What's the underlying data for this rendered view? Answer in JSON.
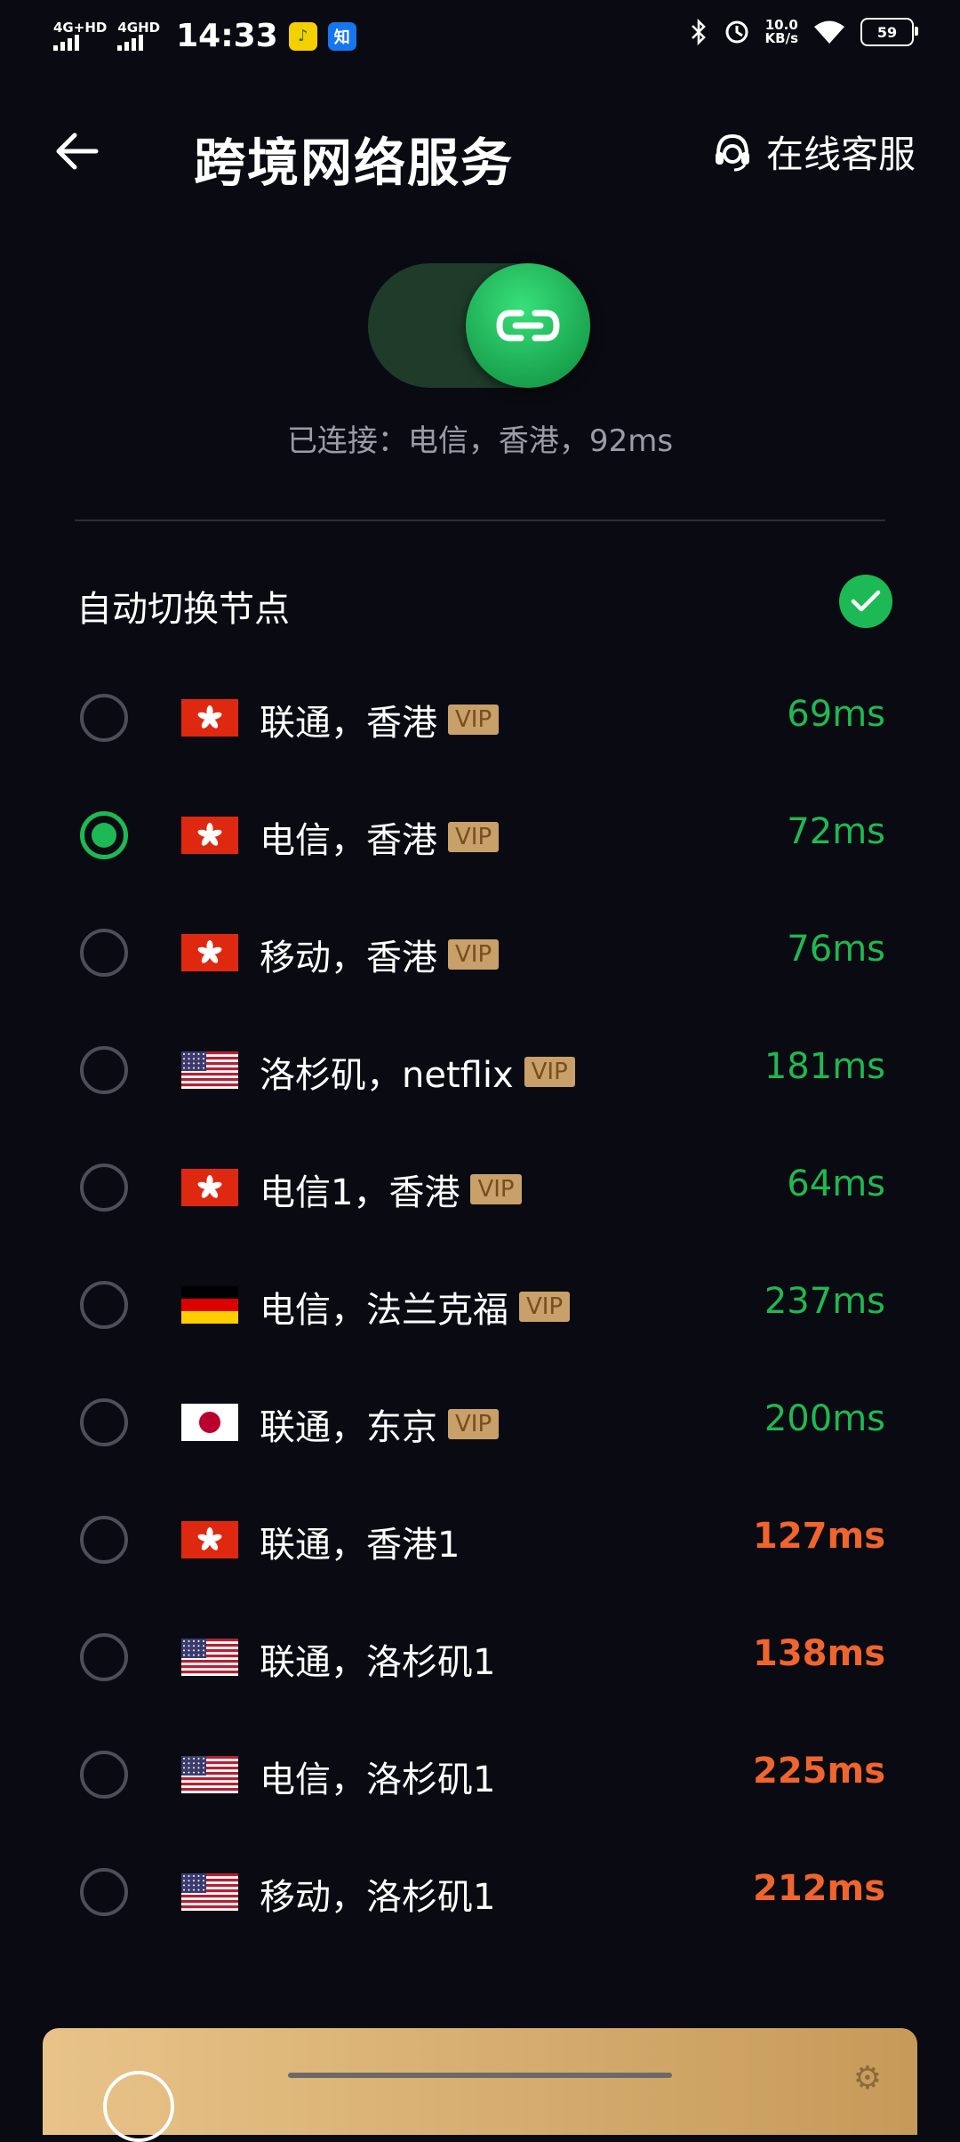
{
  "status_bar": {
    "net1": "4G+HD",
    "net2": "4GHD",
    "time": "14:33",
    "app_icons": [
      "qq-music-icon",
      "zhihu-icon"
    ],
    "app_icon_zhihu_text": "知",
    "speed_value": "10.0",
    "speed_unit": "KB/s",
    "battery": "59"
  },
  "header": {
    "title": "跨境网络服务",
    "support_label": "在线客服"
  },
  "connection": {
    "connected": true,
    "status_text": "已连接：电信，香港，92ms"
  },
  "auto_switch": {
    "label": "自动切换节点",
    "enabled": true
  },
  "vip_label": "VIP",
  "nodes": [
    {
      "flag": "hk",
      "name": "联通，香港",
      "vip": true,
      "latency": "69ms",
      "latency_status": "good",
      "selected": false
    },
    {
      "flag": "hk",
      "name": "电信，香港",
      "vip": true,
      "latency": "72ms",
      "latency_status": "good",
      "selected": true
    },
    {
      "flag": "hk",
      "name": "移动，香港",
      "vip": true,
      "latency": "76ms",
      "latency_status": "good",
      "selected": false
    },
    {
      "flag": "us",
      "name": "洛杉矶，netflix",
      "vip": true,
      "latency": "181ms",
      "latency_status": "good",
      "selected": false
    },
    {
      "flag": "hk",
      "name": "电信1，香港",
      "vip": true,
      "latency": "64ms",
      "latency_status": "good",
      "selected": false
    },
    {
      "flag": "de",
      "name": "电信，法兰克福",
      "vip": true,
      "latency": "237ms",
      "latency_status": "good",
      "selected": false
    },
    {
      "flag": "jp",
      "name": "联通，东京",
      "vip": true,
      "latency": "200ms",
      "latency_status": "good",
      "selected": false
    },
    {
      "flag": "hk",
      "name": "联通，香港1",
      "vip": false,
      "latency": "127ms",
      "latency_status": "bad",
      "selected": false
    },
    {
      "flag": "us",
      "name": "联通，洛杉矶1",
      "vip": false,
      "latency": "138ms",
      "latency_status": "bad",
      "selected": false
    },
    {
      "flag": "us",
      "name": "电信，洛杉矶1",
      "vip": false,
      "latency": "225ms",
      "latency_status": "bad",
      "selected": false
    },
    {
      "flag": "us",
      "name": "移动，洛杉矶1",
      "vip": false,
      "latency": "212ms",
      "latency_status": "bad",
      "selected": false
    }
  ],
  "colors": {
    "background": "#0a0b12",
    "accent": "#1db954",
    "latency_good": "#20b852",
    "latency_bad": "#f0642e",
    "vip_badge": "#c8a06a"
  }
}
